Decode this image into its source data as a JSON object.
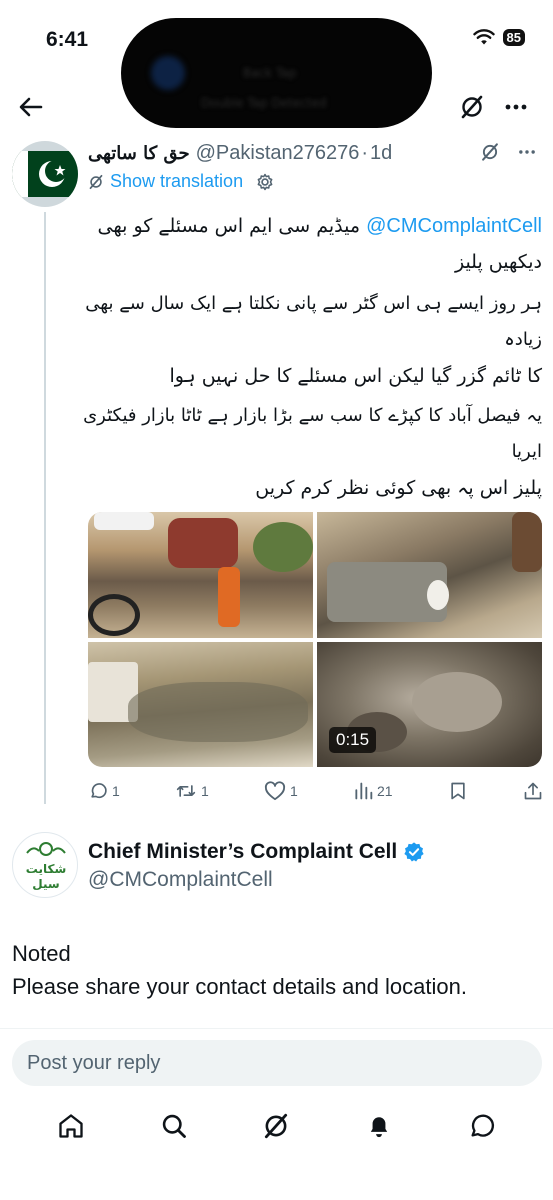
{
  "status_bar": {
    "time": "6:41",
    "battery": "85",
    "dynamic_island": {
      "title": "Back Tap",
      "subtitle": "Double Tap Detected"
    }
  },
  "tweet": {
    "author_name": "حق کا ساتھی",
    "handle": "@Pakistan276276",
    "separator": "·",
    "time_ago": "1d",
    "show_translation": "Show translation",
    "mention": "@CMComplaintCell",
    "line1": "میڈیم سی ایم اس مسئلے کو بھی",
    "line2": "دیکھیں پلیز",
    "line3": "ہر روز ایسے ہی اس گٹر سے پانی نکلتا ہے ایک سال سے بھی زیادہ",
    "line4": "کا ٹائم گزر گیا لیکن اس مسئلے کا حل نہیں ہوا",
    "line5": "یہ فیصل آباد کا کپڑے کا سب سے بڑا بازار ہے ٹاٹا بازار فیکٹری ایریا",
    "line6": "پلیز اس پہ بھی کوئی نظر کرم کریں",
    "video_duration": "0:15",
    "replies": "1",
    "reposts": "1",
    "likes": "1",
    "views": "21"
  },
  "reply": {
    "author_name": "Chief Minister’s Complaint Cell",
    "handle": "@CMComplaintCell",
    "avatar_text_top": "شکایت",
    "avatar_text_bottom": "سیل",
    "line1": "Noted",
    "line2": "Please share your contact details and location."
  },
  "composer": {
    "placeholder": "Post your reply"
  },
  "colors": {
    "accent": "#1d9bf0",
    "muted": "#536471",
    "text": "#0f1419",
    "verified": "#1d9bf0"
  },
  "icons": {
    "top_nav": [
      "back-arrow-icon",
      "grok-icon",
      "more-icon"
    ],
    "actions": [
      "reply-icon",
      "repost-icon",
      "like-icon",
      "views-icon",
      "bookmark-icon",
      "share-icon"
    ],
    "bottom_nav": [
      "home-icon",
      "search-icon",
      "grok-icon",
      "notifications-icon",
      "messages-icon"
    ]
  }
}
